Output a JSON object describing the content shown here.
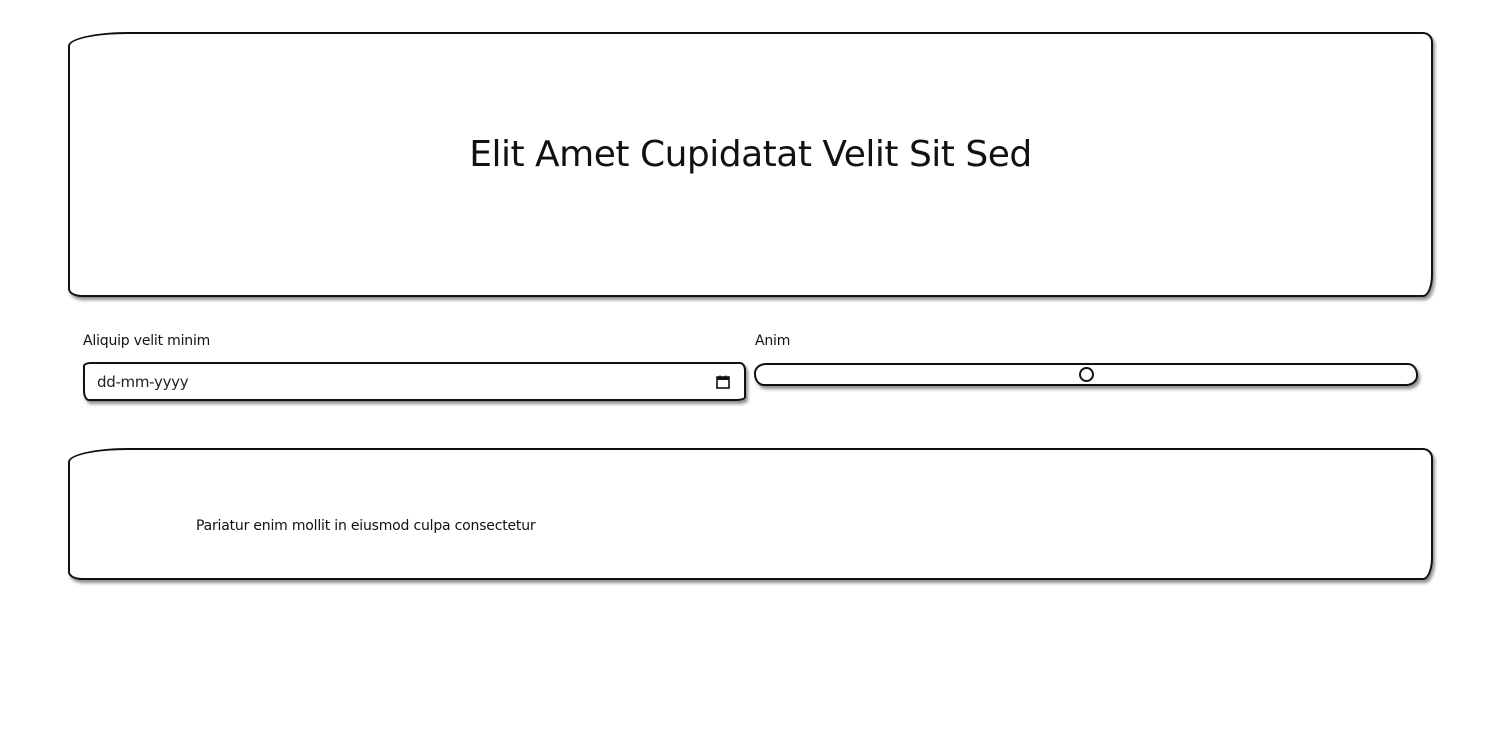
{
  "hero": {
    "title": "Elit Amet Cupidatat Velit Sit Sed"
  },
  "date_field": {
    "label": "Aliquip velit minim",
    "placeholder": "dd-mm-yyyy",
    "icon": "calendar-icon"
  },
  "range_field": {
    "label": "Anim",
    "value_fraction": 0.5
  },
  "note": {
    "text": "Pariatur enim mollit in eiusmod culpa consectetur"
  },
  "colors": {
    "stroke": "#111111",
    "background": "#ffffff"
  }
}
